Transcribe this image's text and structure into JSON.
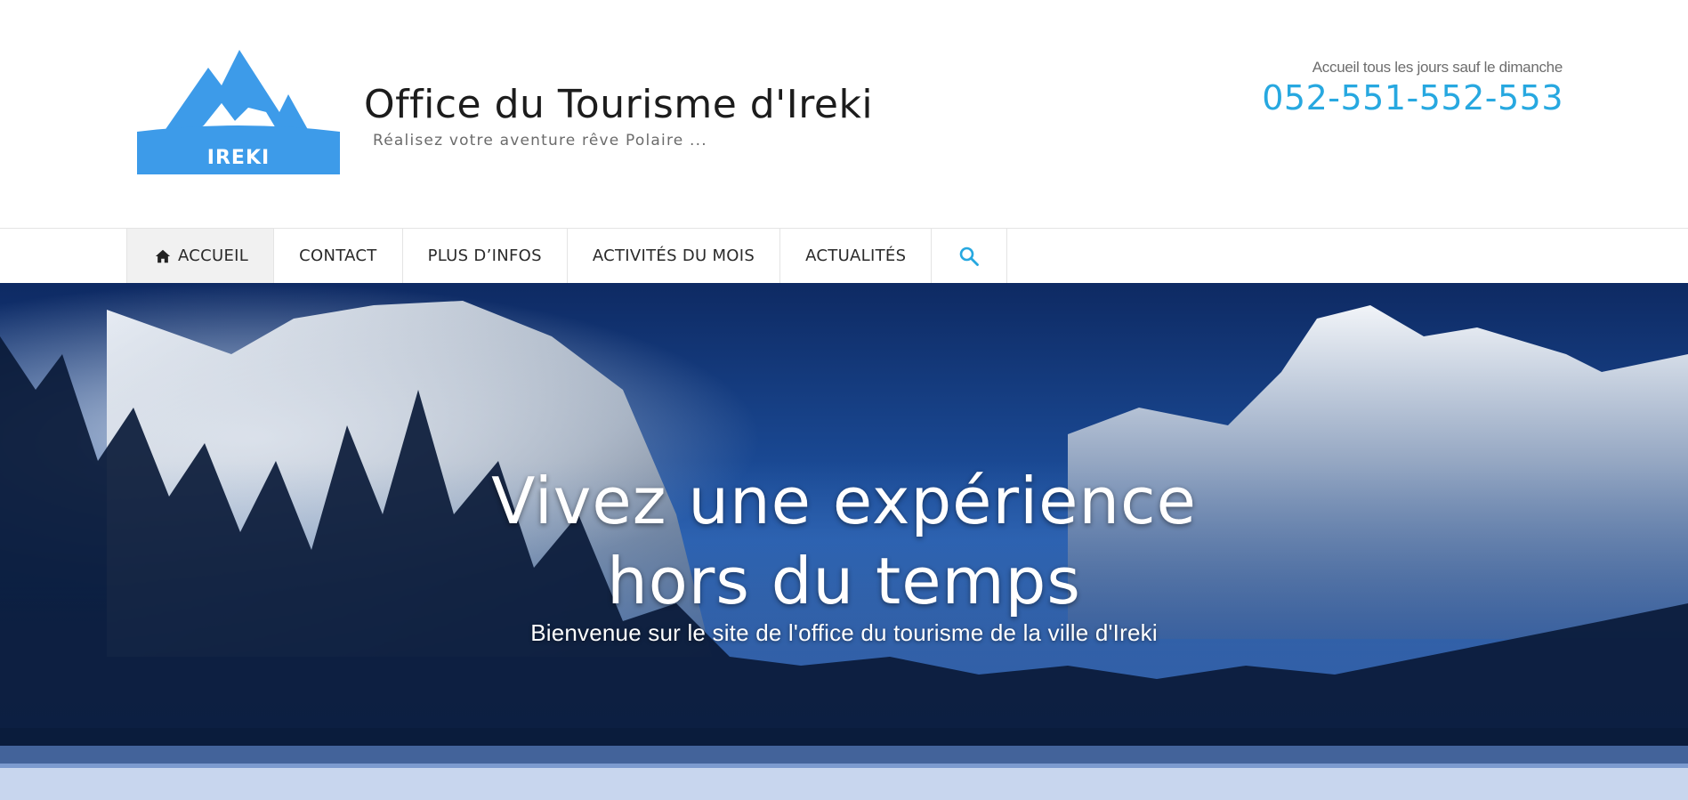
{
  "header": {
    "logo_text": "IREKI",
    "site_title": "Office du Tourisme d'Ireki",
    "tagline": "Réalisez votre aventure rêve Polaire ...",
    "hours": "Accueil tous les jours sauf le dimanche",
    "phone": "052-551-552-553"
  },
  "nav": {
    "items": [
      {
        "label": "Accueil",
        "icon": "home-icon",
        "active": true
      },
      {
        "label": "Contact"
      },
      {
        "label": "Plus d’infos"
      },
      {
        "label": "Activités du mois"
      },
      {
        "label": "Actualités"
      }
    ],
    "search_icon": "search-icon"
  },
  "hero": {
    "heading_line1": "Vivez une expérience",
    "heading_line2": "hors du temps",
    "subtitle": "Bienvenue sur le site de l'office du tourisme de la ville d'Ireki"
  },
  "colors": {
    "accent": "#27a8e0",
    "logo_blue": "#3d9be9",
    "nav_active_bg": "#f1f1f1"
  }
}
